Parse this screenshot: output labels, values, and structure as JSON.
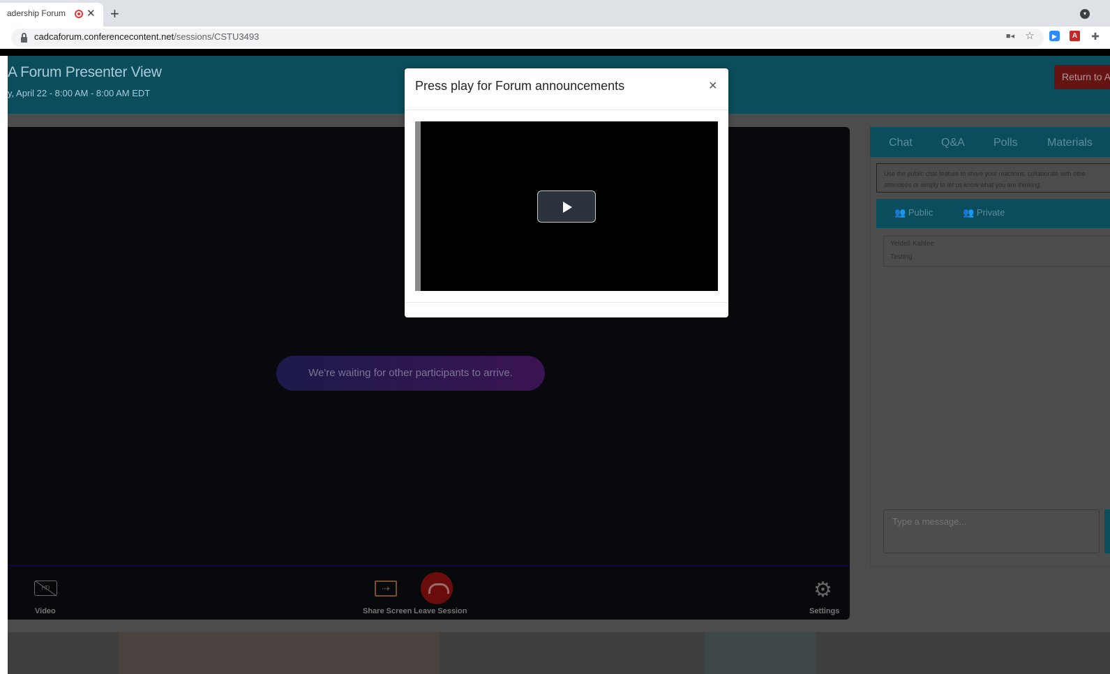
{
  "browser": {
    "tab_title": "adership Forum",
    "close_glyph": "✕",
    "new_tab_glyph": "+",
    "url_host": "cadcaforum.conferencecontent.net",
    "url_path": "/sessions/CSTU3493",
    "icons": [
      "lock-icon",
      "camera-icon",
      "star-icon",
      "zoom-icon",
      "pdf-icon",
      "puzzle-icon",
      "profile-menu-icon"
    ]
  },
  "header": {
    "title": "A Forum Presenter View",
    "date": "y, April 22 - 8:00 AM - 8:00 AM EDT",
    "return_label": "Return to A"
  },
  "video_panel": {
    "waiting_message": "We're waiting for other participants to arrive.",
    "controls": {
      "video_label": "Video",
      "share_label": "Share Screen",
      "leave_label": "Leave Session",
      "settings_label": "Settings"
    }
  },
  "side_panel": {
    "tabs": [
      "Chat",
      "Q&A",
      "Polls",
      "Materials"
    ],
    "notice_line1": "Use the public chat feature to share your reactions, collaborate with othe",
    "notice_line2": "attendees or simply to let us know what you are thinking.",
    "subtabs": [
      "Public",
      "Private"
    ],
    "messages": [
      {
        "author": "Yeldell Kahlee",
        "text": "Testing"
      }
    ],
    "input_placeholder": "Type a message..."
  },
  "modal": {
    "title": "Press play for Forum announcements",
    "close_glyph": "×"
  },
  "colors": {
    "header_bg": "#0b4d5c",
    "return_button": "#651414",
    "leave_button": "#6b0c0c",
    "share_icon": "#7a5023"
  }
}
